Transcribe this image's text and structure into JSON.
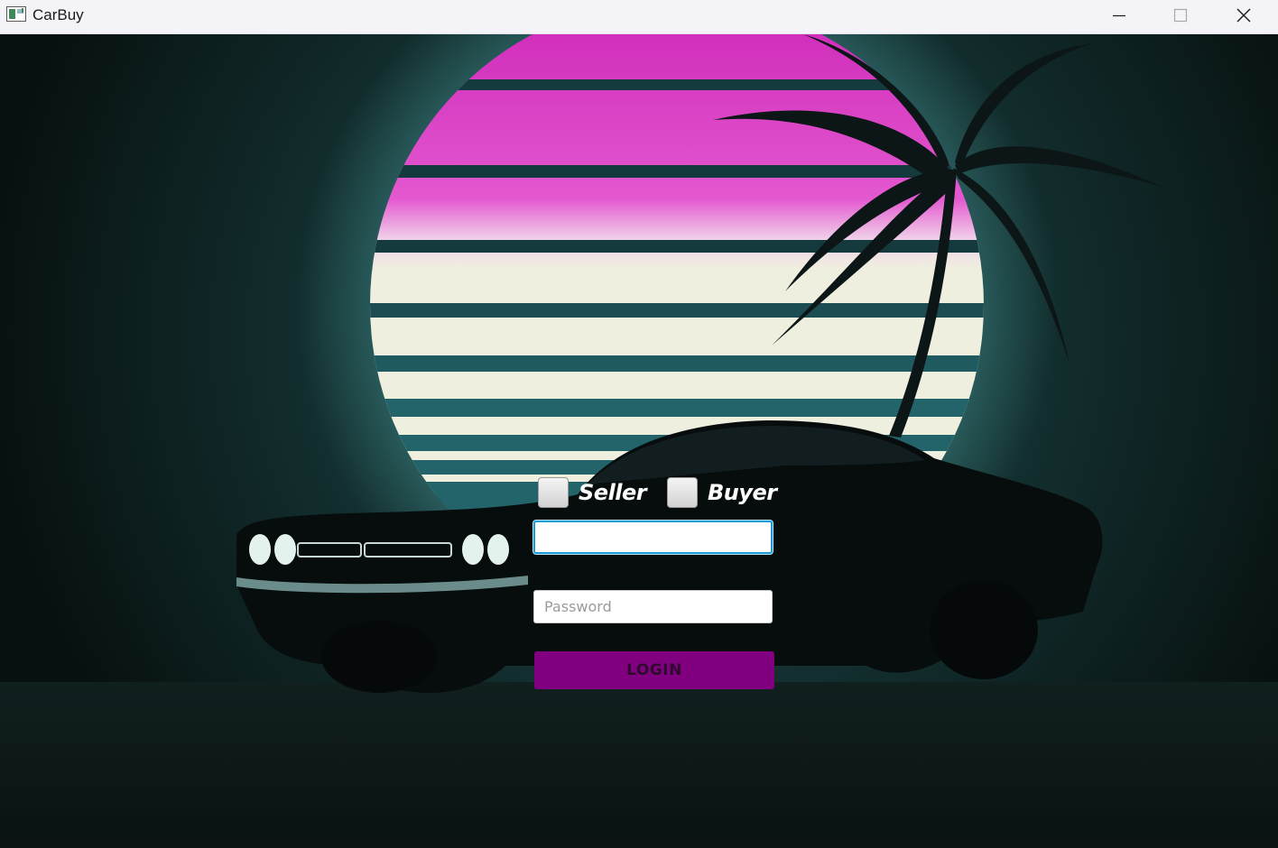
{
  "window": {
    "title": "CarBuy",
    "controls": {
      "minimize": "minimize-icon",
      "maximize": "maximize-icon",
      "close": "close-icon"
    }
  },
  "login": {
    "role_options": [
      {
        "label": "Seller",
        "checked": false
      },
      {
        "label": "Buyer",
        "checked": false
      }
    ],
    "username": {
      "value": "",
      "placeholder": ""
    },
    "password": {
      "value": "",
      "placeholder": "Password"
    },
    "submit_label": "LOGIN"
  },
  "colors": {
    "sun_pink": "#dc3cc3",
    "sun_cream": "#efefdf",
    "background": "#0b1414",
    "login_button": "#800080",
    "focus_border": "#1a9bd7"
  }
}
